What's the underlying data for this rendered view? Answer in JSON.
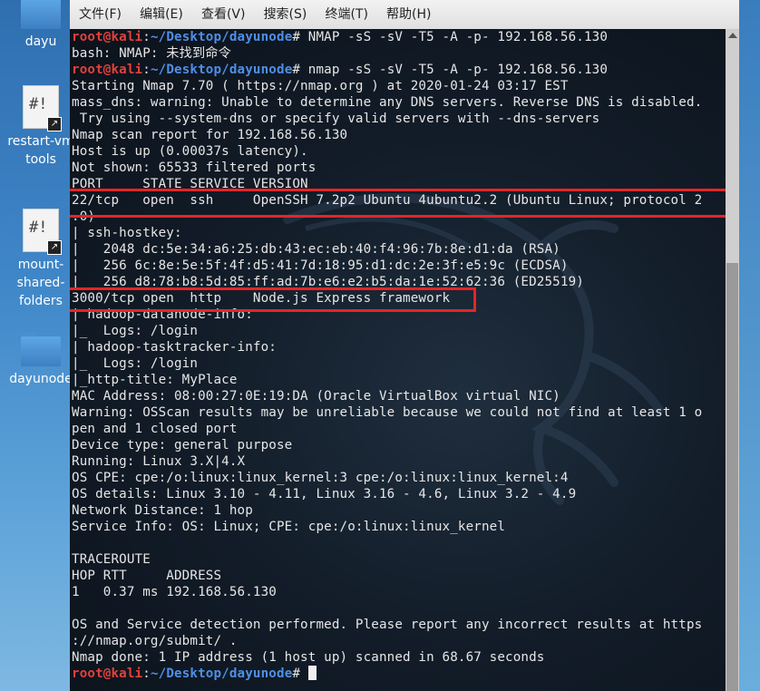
{
  "desktop": {
    "icons": [
      {
        "label": "dayu",
        "type": "folder"
      },
      {
        "label": "restart-vm\ntools",
        "type": "script"
      },
      {
        "label": "mount-\nshared-\nfolders",
        "type": "script"
      },
      {
        "label": "dayunode",
        "type": "folder"
      }
    ]
  },
  "terminal": {
    "menu": [
      "文件(F)",
      "编辑(E)",
      "查看(V)",
      "搜索(S)",
      "终端(T)",
      "帮助(H)"
    ],
    "prompt_user": "root@kali",
    "prompt_path": "~/Desktop/dayunode",
    "lines": [
      {
        "kind": "prompt",
        "cmd": " NMAP -sS -sV -T5 -A -p- 192.168.56.130"
      },
      {
        "kind": "out",
        "text": "bash: NMAP: 未找到命令"
      },
      {
        "kind": "prompt",
        "cmd": " nmap -sS -sV -T5 -A -p- 192.168.56.130"
      },
      {
        "kind": "out",
        "text": "Starting Nmap 7.70 ( https://nmap.org ) at 2020-01-24 03:17 EST"
      },
      {
        "kind": "out",
        "text": "mass_dns: warning: Unable to determine any DNS servers. Reverse DNS is disabled."
      },
      {
        "kind": "out",
        "text": " Try using --system-dns or specify valid servers with --dns-servers"
      },
      {
        "kind": "out",
        "text": "Nmap scan report for 192.168.56.130"
      },
      {
        "kind": "out",
        "text": "Host is up (0.00037s latency)."
      },
      {
        "kind": "out",
        "text": "Not shown: 65533 filtered ports"
      },
      {
        "kind": "out",
        "text": "PORT     STATE SERVICE VERSION"
      },
      {
        "kind": "out",
        "text": "22/tcp   open  ssh     OpenSSH 7.2p2 Ubuntu 4ubuntu2.2 (Ubuntu Linux; protocol 2"
      },
      {
        "kind": "out",
        "text": ".0)"
      },
      {
        "kind": "out",
        "text": "| ssh-hostkey:"
      },
      {
        "kind": "out",
        "text": "|   2048 dc:5e:34:a6:25:db:43:ec:eb:40:f4:96:7b:8e:d1:da (RSA)"
      },
      {
        "kind": "out",
        "text": "|   256 6c:8e:5e:5f:4f:d5:41:7d:18:95:d1:dc:2e:3f:e5:9c (ECDSA)"
      },
      {
        "kind": "out",
        "text": "|_  256 d8:78:b8:5d:85:ff:ad:7b:e6:e2:b5:da:1e:52:62:36 (ED25519)"
      },
      {
        "kind": "out",
        "text": "3000/tcp open  http    Node.js Express framework"
      },
      {
        "kind": "out",
        "text": "| hadoop-datanode-info:"
      },
      {
        "kind": "out",
        "text": "|_  Logs: /login"
      },
      {
        "kind": "out",
        "text": "| hadoop-tasktracker-info:"
      },
      {
        "kind": "out",
        "text": "|_  Logs: /login"
      },
      {
        "kind": "out",
        "text": "|_http-title: MyPlace"
      },
      {
        "kind": "out",
        "text": "MAC Address: 08:00:27:0E:19:DA (Oracle VirtualBox virtual NIC)"
      },
      {
        "kind": "out",
        "text": "Warning: OSScan results may be unreliable because we could not find at least 1 o"
      },
      {
        "kind": "out",
        "text": "pen and 1 closed port"
      },
      {
        "kind": "out",
        "text": "Device type: general purpose"
      },
      {
        "kind": "out",
        "text": "Running: Linux 3.X|4.X"
      },
      {
        "kind": "out",
        "text": "OS CPE: cpe:/o:linux:linux_kernel:3 cpe:/o:linux:linux_kernel:4"
      },
      {
        "kind": "out",
        "text": "OS details: Linux 3.10 - 4.11, Linux 3.16 - 4.6, Linux 3.2 - 4.9"
      },
      {
        "kind": "out",
        "text": "Network Distance: 1 hop"
      },
      {
        "kind": "out",
        "text": "Service Info: OS: Linux; CPE: cpe:/o:linux:linux_kernel"
      },
      {
        "kind": "out",
        "text": ""
      },
      {
        "kind": "out",
        "text": "TRACEROUTE"
      },
      {
        "kind": "out",
        "text": "HOP RTT     ADDRESS"
      },
      {
        "kind": "out",
        "text": "1   0.37 ms 192.168.56.130"
      },
      {
        "kind": "out",
        "text": ""
      },
      {
        "kind": "out",
        "text": "OS and Service detection performed. Please report any incorrect results at https"
      },
      {
        "kind": "out",
        "text": "://nmap.org/submit/ ."
      },
      {
        "kind": "out",
        "text": "Nmap done: 1 IP address (1 host up) scanned in 68.67 seconds"
      },
      {
        "kind": "prompt",
        "cmd": "",
        "cursor": true
      }
    ]
  },
  "colors": {
    "prompt_user": "#e0413b",
    "prompt_path": "#4f8fe6",
    "highlight_box": "#e32626",
    "terminal_bg": "#121c28"
  }
}
